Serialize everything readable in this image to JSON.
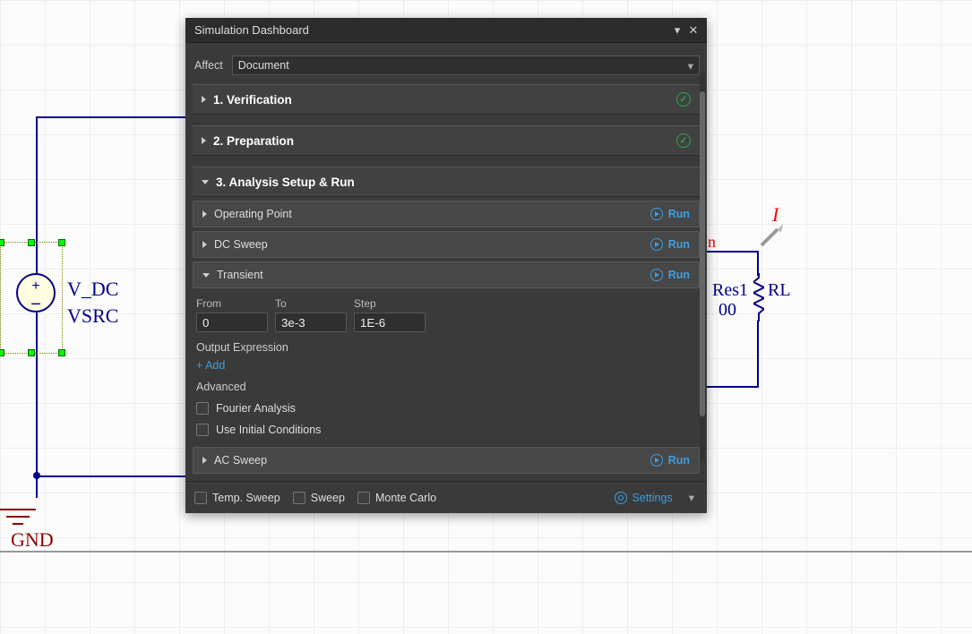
{
  "schematic": {
    "vsrc": {
      "ref": "V_DC",
      "type": "VSRC"
    },
    "gnd": "GND",
    "res": {
      "ref1": "Res1",
      "refR": "RL",
      "val": "00"
    },
    "probe": "I",
    "fragment": "n"
  },
  "panel": {
    "title": "Simulation Dashboard",
    "affect_label": "Affect",
    "affect_value": "Document",
    "sections": {
      "verification": "1. Verification",
      "preparation": "2. Preparation",
      "analysis": "3. Analysis Setup & Run"
    },
    "subs": {
      "op": "Operating Point",
      "dc": "DC Sweep",
      "tran": "Transient",
      "ac": "AC Sweep"
    },
    "run": "Run",
    "tran": {
      "from_label": "From",
      "to_label": "To",
      "step_label": "Step",
      "from": "0",
      "to": "3e-3",
      "step": "1E-6",
      "out_expr": "Output Expression",
      "add": "+ Add",
      "advanced": "Advanced",
      "fourier": "Fourier Analysis",
      "init": "Use Initial Conditions"
    },
    "footer": {
      "temp": "Temp. Sweep",
      "sweep": "Sweep",
      "mc": "Monte Carlo",
      "settings": "Settings"
    }
  }
}
